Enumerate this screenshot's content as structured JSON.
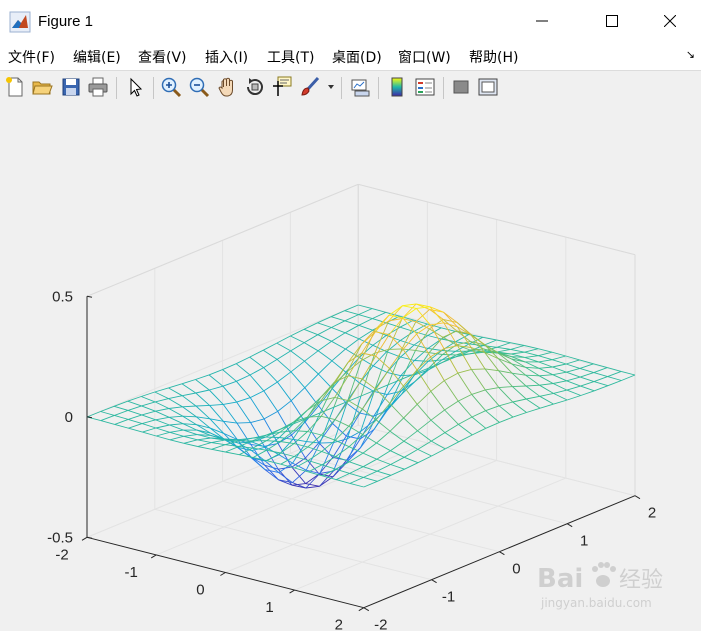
{
  "window": {
    "title": "Figure 1"
  },
  "menu": [
    "文件(F)",
    "编辑(E)",
    "查看(V)",
    "插入(I)",
    "工具(T)",
    "桌面(D)",
    "窗口(W)",
    "帮助(H)"
  ],
  "toolbar": [
    "new-figure",
    "open-file",
    "save",
    "print",
    "edit-plot",
    "zoom-in",
    "zoom-out",
    "pan",
    "rotate-3d",
    "data-cursor",
    "brush",
    "link-plot",
    "colorbar",
    "legend",
    "hide-tools",
    "show-tools"
  ],
  "chart_data": {
    "type": "surface-mesh",
    "function": "z = x*exp(-x^2-y^2)",
    "x_range": [
      -2,
      2
    ],
    "y_range": [
      -2,
      2
    ],
    "z_range": [
      -0.5,
      0.5
    ],
    "grid_points": 21,
    "colormap": "parula",
    "x_ticks": [
      "-2",
      "-1",
      "0",
      "1",
      "2"
    ],
    "y_ticks": [
      "-2",
      "-1",
      "0",
      "1",
      "2"
    ],
    "z_ticks": [
      "-0.5",
      "0",
      "0.5"
    ],
    "grid": true
  },
  "watermark": {
    "brand": "Bai",
    "brand2": "经验",
    "url": "jingyan.baidu.com"
  }
}
